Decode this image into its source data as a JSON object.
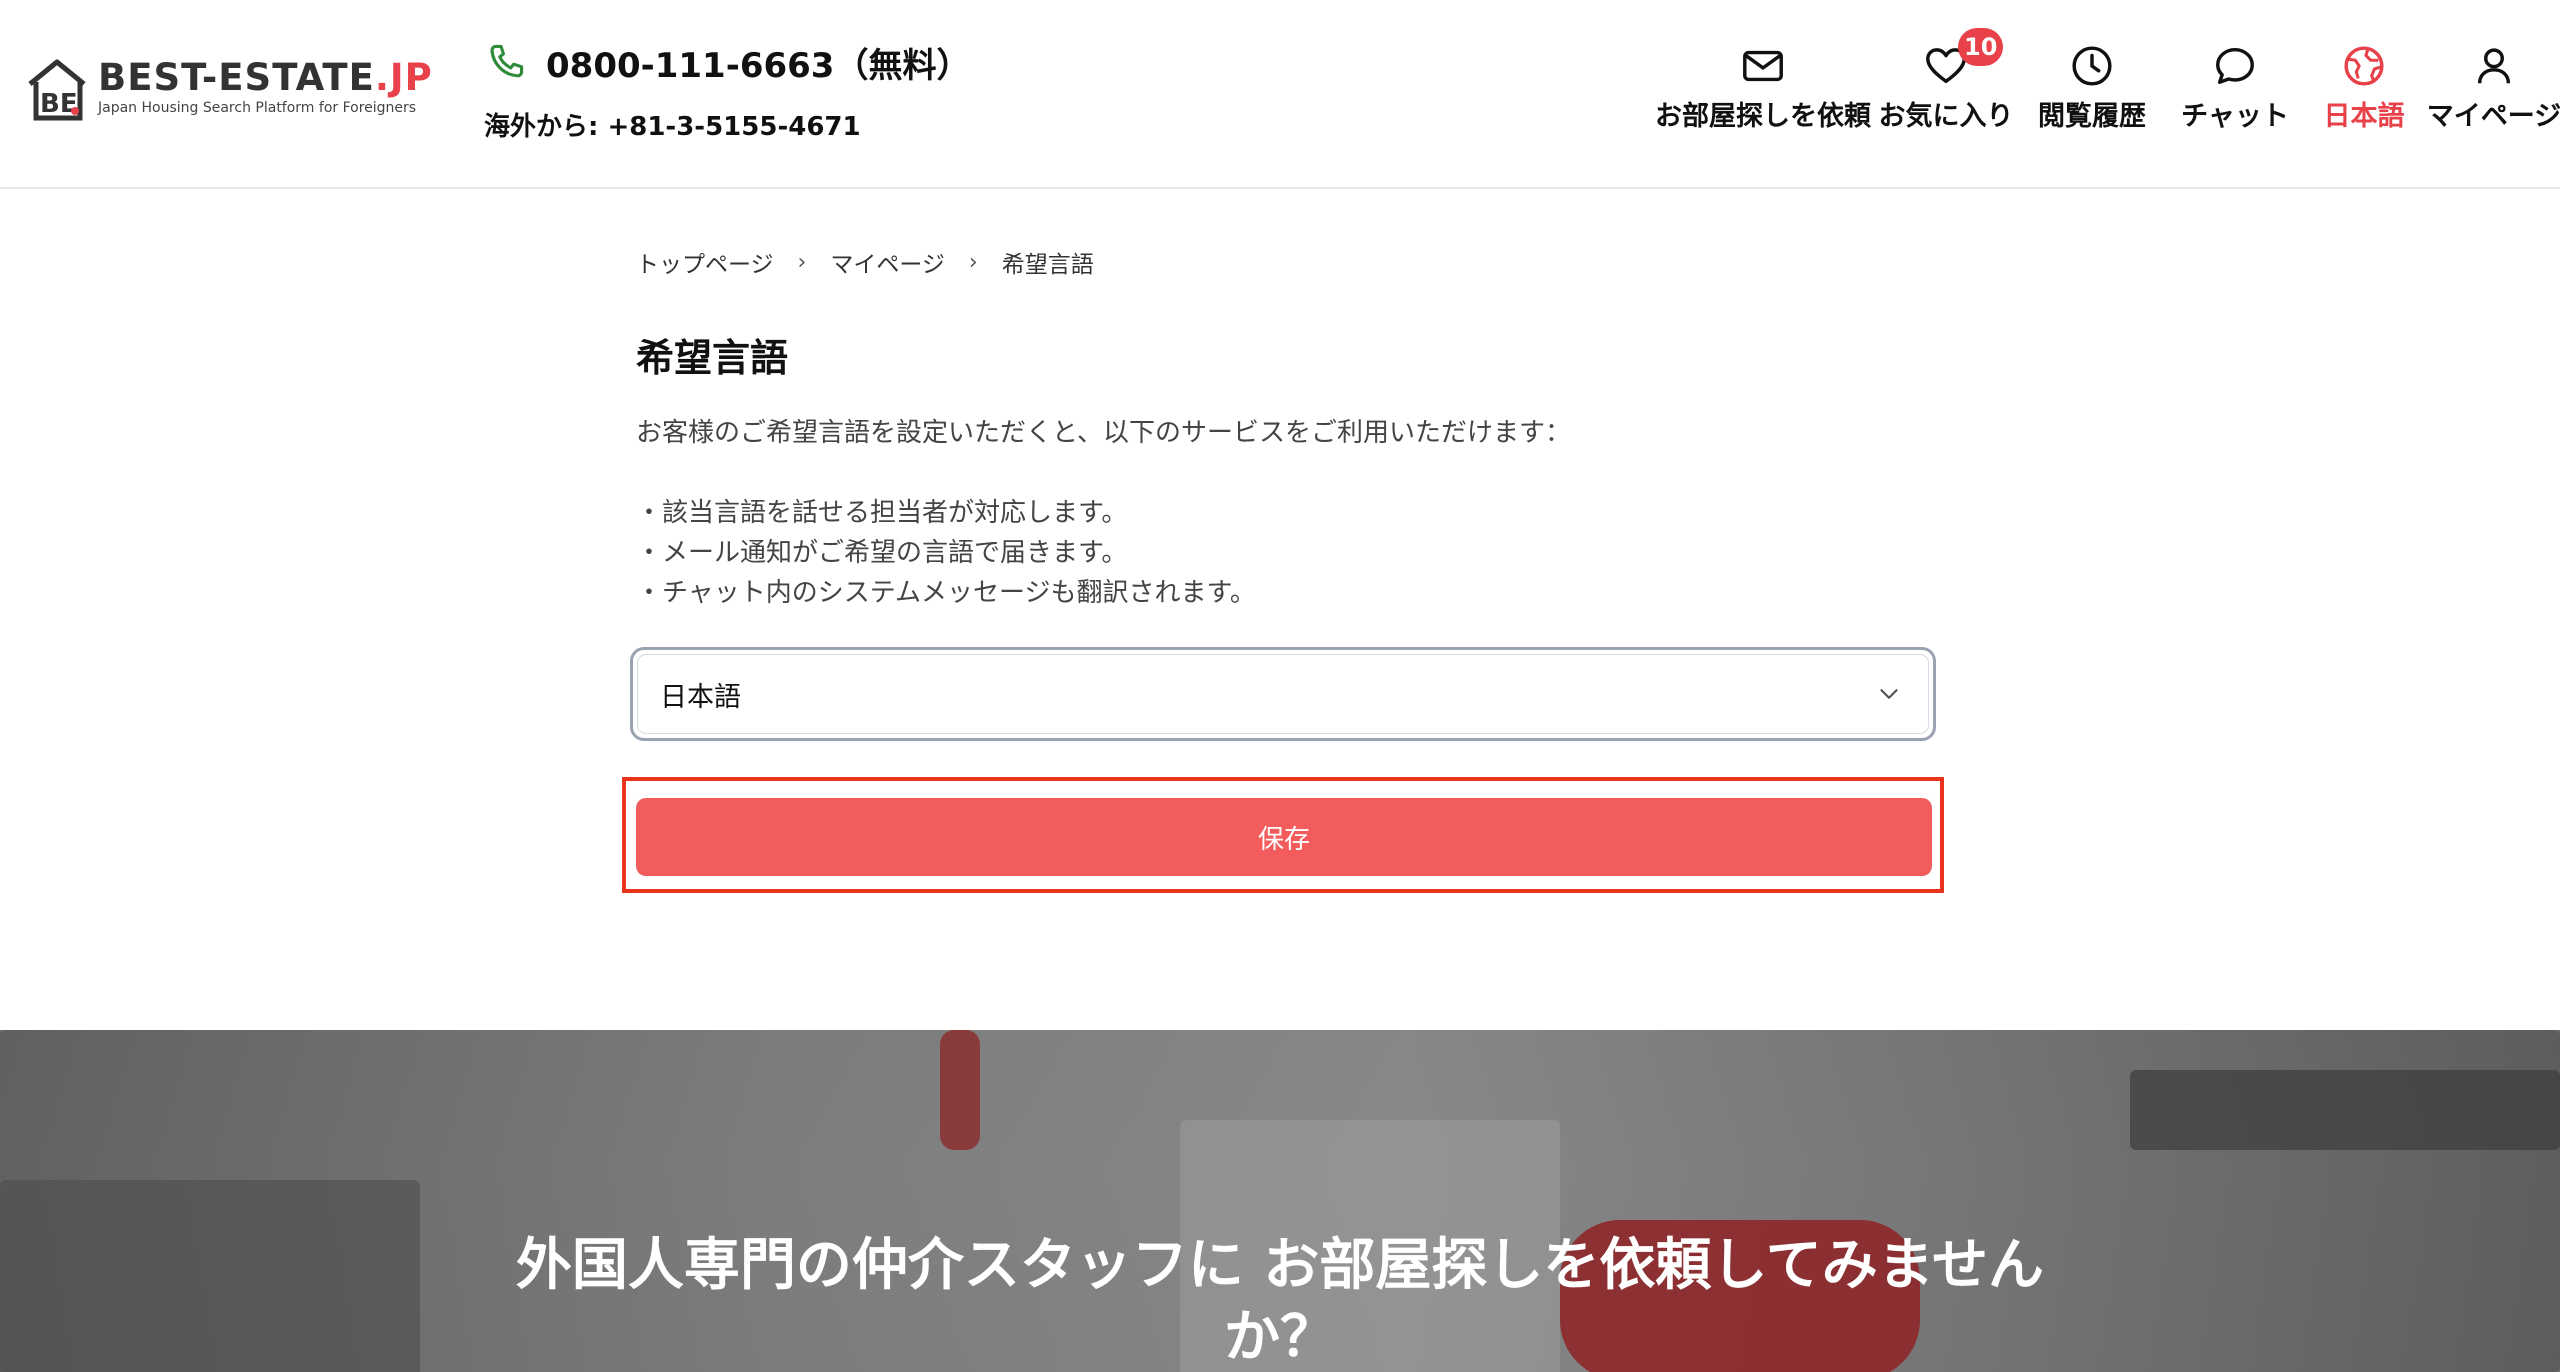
{
  "header": {
    "logo": {
      "title": "BEST-ESTATE",
      "title_suffix": ".JP",
      "subtitle": "Japan Housing Search Platform for Foreigners",
      "mark_text": "BE"
    },
    "phone": "0800-111-6663（無料）",
    "overseas": "海外から: +81-3-5155-4671",
    "nav": [
      {
        "label": "お部屋探しを依頼",
        "icon": "mail-icon"
      },
      {
        "label": "お気に入り",
        "icon": "heart-icon",
        "badge": "10"
      },
      {
        "label": "閲覧履歴",
        "icon": "clock-icon"
      },
      {
        "label": "チャット",
        "icon": "chat-bubble-icon"
      },
      {
        "label": "日本語",
        "icon": "globe-icon",
        "active": true
      },
      {
        "label": "マイページ",
        "icon": "user-icon"
      }
    ]
  },
  "breadcrumb": [
    "トップページ",
    "マイページ",
    "希望言語"
  ],
  "breadcrumb_sep": "›",
  "page": {
    "title": "希望言語",
    "description": "お客様のご希望言語を設定いただくと、以下のサービスをご利用いただけます：",
    "benefits": [
      "・該当言語を話せる担当者が対応します。",
      "・メール通知がご希望の言語で届きます。",
      "・チャット内のシステムメッセージも翻訳されます。"
    ],
    "select_value": "日本語",
    "save_label": "保存"
  },
  "hero": {
    "line1": "外国人専門の仲介スタッフに お部屋探しを依頼してみません",
    "line2": "か？"
  },
  "colors": {
    "accent": "#e8414a",
    "save_button": "#f25c5c",
    "highlight_frame": "#e8341c",
    "phone_icon": "#2e8b3a"
  }
}
